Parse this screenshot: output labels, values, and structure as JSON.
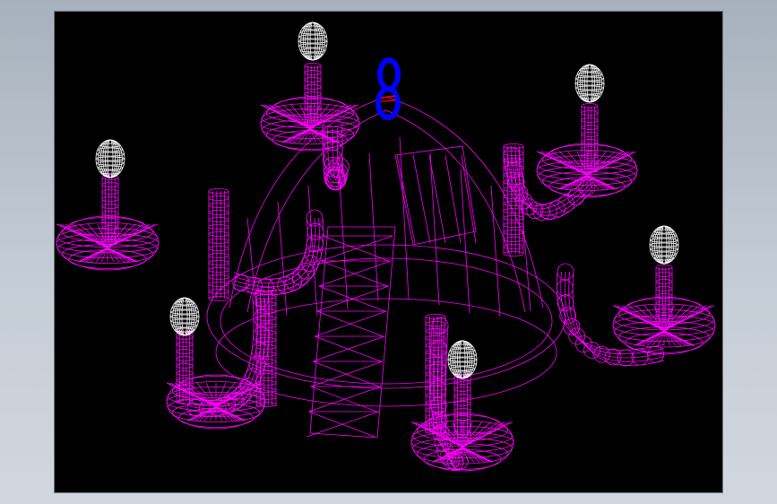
{
  "viewport": {
    "background": "#000000",
    "surround": "#b8c1cb"
  },
  "model": {
    "type": "chandelier-wireframe",
    "arm_count": 6,
    "colors": {
      "body": "#ff00ff",
      "candle_flames": "#ffffff",
      "hanging_ring": "#0000ff",
      "ring_detail": "#ff0000"
    }
  }
}
